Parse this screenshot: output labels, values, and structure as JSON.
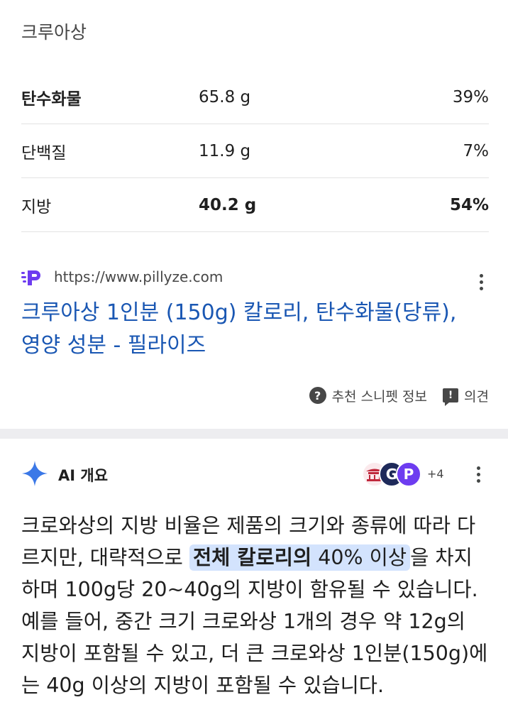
{
  "food": {
    "title": "크루아상"
  },
  "nutrition": {
    "rows": [
      {
        "name": "탄수화물",
        "amount": "65.8 g",
        "percent": "39%",
        "bold_name": true,
        "bold_values": false
      },
      {
        "name": "단백질",
        "amount": "11.9 g",
        "percent": "7%",
        "bold_name": false,
        "bold_values": false
      },
      {
        "name": "지방",
        "amount": "40.2 g",
        "percent": "54%",
        "bold_name": false,
        "bold_values": true
      }
    ]
  },
  "source": {
    "url": "https://www.pillyze.com",
    "favicon_icon": "pillyze-p-icon",
    "link_title": "크루아상 1인분 (150g) 칼로리, 탄수화물(당류), 영양 성분 - 필라이즈",
    "more_icon": "more-vert-icon"
  },
  "snippet_meta": {
    "about_label": "추천 스니펫 정보",
    "feedback_label": "의견"
  },
  "ai_overview": {
    "title": "AI 개요",
    "source_count": "+4",
    "text_before": "크로와상의 지방 비율은 제품의 크기와 종류에 따라 다르지만, 대략적으로 ",
    "highlight_bold": "전체 칼로리의",
    "highlight_rest": " 40% 이상",
    "text_after": "을 차지하며 100g당 20~40g의 지방이 함유될 수 있습니다. 예를 들어, 중간 크기 크로와상 1개의 경우 약 12g의 지방이 포함될 수 있고, 더 큰 크로와상 1인분(150g)에는 40g 이상의 지방이 포함될 수 있습니다."
  },
  "colors": {
    "link": "#1a57b3",
    "highlight": "#d3e3fd",
    "divider": "#ededf0",
    "sparkle": "#3b78e7"
  }
}
